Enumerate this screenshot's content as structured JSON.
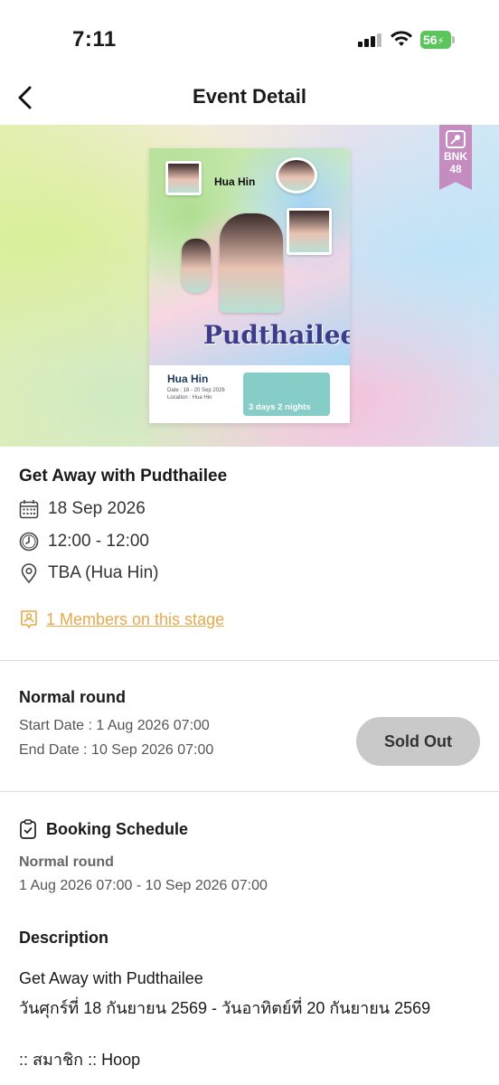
{
  "status_bar": {
    "time": "7:11",
    "battery": "56"
  },
  "header": {
    "title": "Event Detail"
  },
  "banner": {
    "poster_city": "Hua Hin",
    "poster_script": "Pudthailee",
    "poster_bottom_title": "Hua Hin",
    "poster_bottom_sub": "Date : 18 - 20 Sep 2026\nLocation : Hua Hin",
    "poster_nights": "3 days 2 nights",
    "badge_text": "BNK 48"
  },
  "event": {
    "title": "Get Away with Pudthailee",
    "date": "18 Sep 2026",
    "time": "12:00 - 12:00",
    "location": "TBA (Hua Hin)",
    "members_link": "1 Members on this stage"
  },
  "round": {
    "title": "Normal round",
    "start": "Start Date : 1 Aug 2026 07:00",
    "end": "End Date : 10 Sep 2026 07:00",
    "button_label": "Sold Out"
  },
  "booking": {
    "title": "Booking Schedule",
    "round_name": "Normal round",
    "range": "1 Aug 2026 07:00 - 10 Sep 2026 07:00"
  },
  "description": {
    "title": "Description",
    "lines": [
      "Get Away with Pudthailee",
      "วันศุกร์ที่ 18 กันยายน 2569 - วันอาทิตย์ที่ 20 กันยายน 2569",
      "",
      ":: สมาชิก :: Hoop"
    ]
  },
  "colors": {
    "accent": "#e9a94a",
    "badge": "#c58cc0",
    "soldout_bg": "#c9c9c9"
  }
}
